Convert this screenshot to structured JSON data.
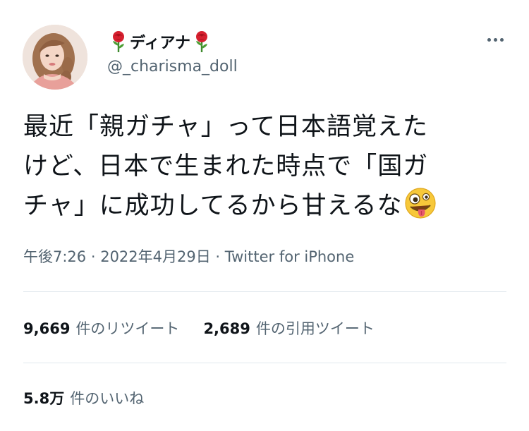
{
  "tweet": {
    "author": {
      "display_name": "ディアナ",
      "handle": "@_charisma_doll",
      "name_icons": [
        "rose-emoji",
        "rose-emoji"
      ]
    },
    "text_lines": [
      "最近「親ガチャ」って日本語覚えた",
      "けど、日本で生まれた時点で「国ガ",
      "チャ」に成功してるから甘えるな"
    ],
    "text_emoji": "zany-face-emoji",
    "meta": {
      "time": "午後7:26",
      "separator": " · ",
      "date": "2022年4月29日",
      "source": "Twitter for iPhone"
    },
    "stats": {
      "retweets_count": "9,669",
      "retweets_label": "件のリツイート",
      "quotes_count": "2,689",
      "quotes_label": "件の引用ツイート",
      "likes_count": "5.8万",
      "likes_label": "件のいいね"
    }
  },
  "colors": {
    "text_primary": "#0f1419",
    "text_secondary": "#536471",
    "divider": "#e1e8ed"
  }
}
